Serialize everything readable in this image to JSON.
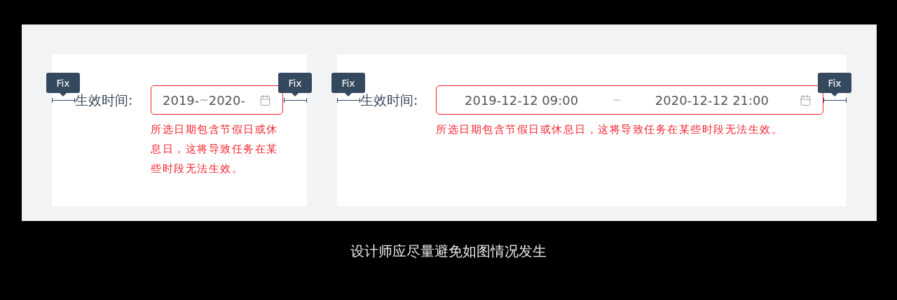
{
  "panels": [
    {
      "kind": "narrow",
      "label": "生效时间:",
      "start": "2019-",
      "separator": "~",
      "end": "2020-",
      "error": "所选日期包含节假日或休息日，这将导致任务在某些时段无法生效。",
      "tags": [
        "Fix",
        "Fix"
      ]
    },
    {
      "kind": "wide",
      "label": "生效时间:",
      "start": "2019-12-12 09:00",
      "separator": "~",
      "end": "2020-12-12 21:00",
      "error": "所选日期包含节假日或休息日，这将导致任务在某些时段无法生效。",
      "tags": [
        "Fix",
        "Fix"
      ]
    }
  ],
  "caption": "设计师应尽量避免如图情况发生"
}
